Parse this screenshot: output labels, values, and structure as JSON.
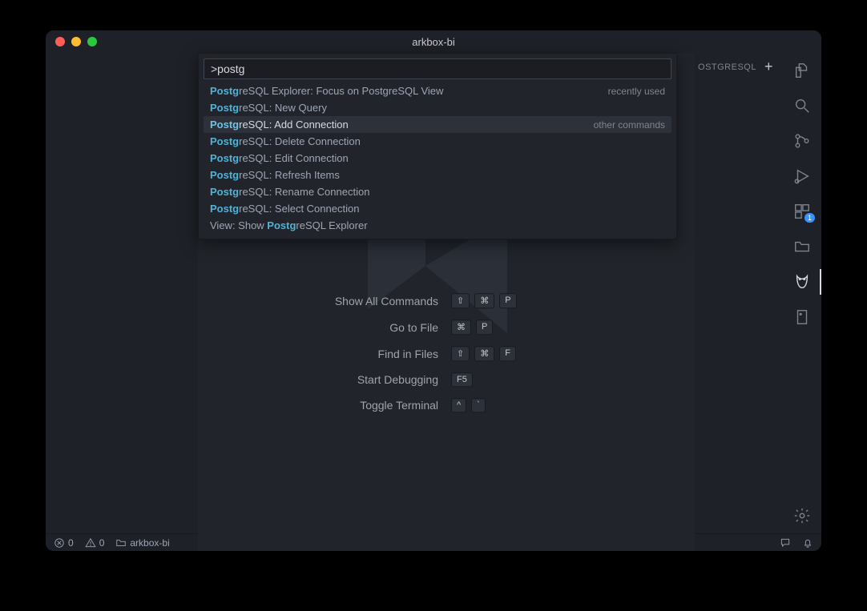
{
  "window": {
    "title": "arkbox-bi"
  },
  "tabbar": {
    "label": "OSTGRESQL"
  },
  "palette": {
    "input_value": ">postg",
    "items": [
      {
        "prefix": "Postg",
        "rest": "reSQL Explorer: Focus on PostgreSQL View",
        "hint": "recently used",
        "selected": false
      },
      {
        "prefix": "Postg",
        "rest": "reSQL: New Query",
        "hint": "",
        "selected": false
      },
      {
        "prefix": "Postg",
        "rest": "reSQL: Add Connection",
        "hint": "other commands",
        "selected": true
      },
      {
        "prefix": "Postg",
        "rest": "reSQL: Delete Connection",
        "hint": "",
        "selected": false
      },
      {
        "prefix": "Postg",
        "rest": "reSQL: Edit Connection",
        "hint": "",
        "selected": false
      },
      {
        "prefix": "Postg",
        "rest": "reSQL: Refresh Items",
        "hint": "",
        "selected": false
      },
      {
        "prefix": "Postg",
        "rest": "reSQL: Rename Connection",
        "hint": "",
        "selected": false
      },
      {
        "prefix": "Postg",
        "rest": "reSQL: Select Connection",
        "hint": "",
        "selected": false
      },
      {
        "prefix": "View: Show ",
        "rest": "",
        "mid": "Postg",
        "tail": "reSQL Explorer",
        "selected": false
      }
    ]
  },
  "watermark": {
    "rows": [
      {
        "label": "Show All Commands",
        "keys": [
          "⇧",
          "⌘",
          "P"
        ]
      },
      {
        "label": "Go to File",
        "keys": [
          "⌘",
          "P"
        ]
      },
      {
        "label": "Find in Files",
        "keys": [
          "⇧",
          "⌘",
          "F"
        ]
      },
      {
        "label": "Start Debugging",
        "keys": [
          "F5"
        ]
      },
      {
        "label": "Toggle Terminal",
        "keys": [
          "^",
          "`"
        ]
      }
    ]
  },
  "activitybar": {
    "extensions_badge": "1"
  },
  "statusbar": {
    "errors": "0",
    "warnings": "0",
    "folder": "arkbox-bi"
  }
}
